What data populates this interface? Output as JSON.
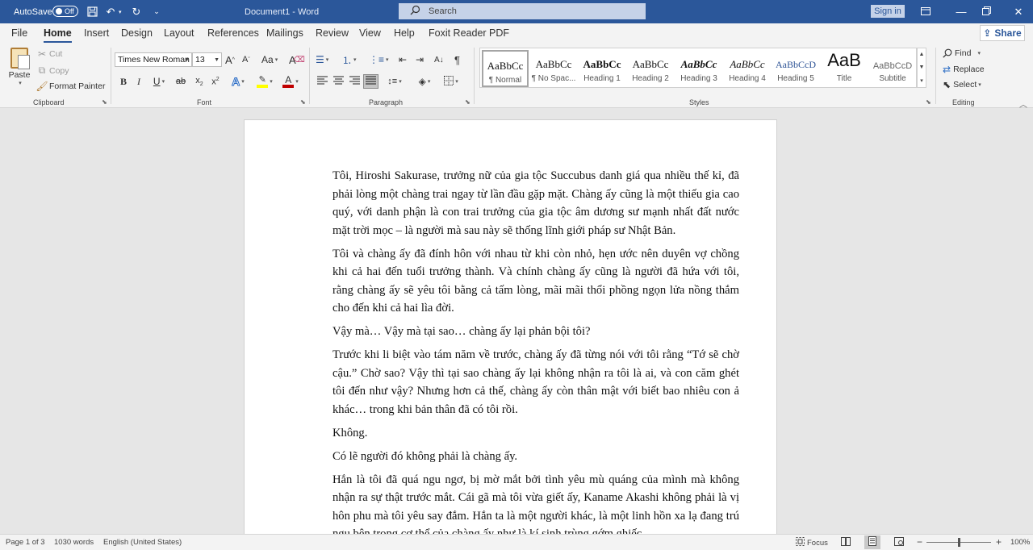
{
  "titlebar": {
    "autosave_label": "AutoSave",
    "autosave_state": "Off",
    "doc_title": "Document1  -  Word",
    "search_placeholder": "Search",
    "signin_label": "Sign in"
  },
  "tabs": [
    "File",
    "Home",
    "Insert",
    "Design",
    "Layout",
    "References",
    "Mailings",
    "Review",
    "View",
    "Help",
    "Foxit Reader PDF"
  ],
  "active_tab": "Home",
  "share_label": "Share",
  "clipboard": {
    "paste_label": "Paste",
    "cut_label": "Cut",
    "copy_label": "Copy",
    "format_painter_label": "Format Painter",
    "group_label": "Clipboard"
  },
  "font": {
    "name": "Times New Roman",
    "size": "13",
    "group_label": "Font"
  },
  "paragraph": {
    "group_label": "Paragraph"
  },
  "styles": {
    "group_label": "Styles",
    "items": [
      {
        "sample": "AaBbCc",
        "name": "¶ Normal"
      },
      {
        "sample": "AaBbCc",
        "name": "¶ No Spac..."
      },
      {
        "sample": "AaBbCc",
        "name": "Heading 1"
      },
      {
        "sample": "AaBbCc",
        "name": "Heading 2"
      },
      {
        "sample": "AaBbCc",
        "name": "Heading 3"
      },
      {
        "sample": "AaBbCc",
        "name": "Heading 4"
      },
      {
        "sample": "AaBbCcD",
        "name": "Heading 5"
      },
      {
        "sample": "AaB",
        "name": "Title"
      },
      {
        "sample": "AaBbCcD",
        "name": "Subtitle"
      }
    ]
  },
  "editing": {
    "find_label": "Find",
    "replace_label": "Replace",
    "select_label": "Select",
    "group_label": "Editing"
  },
  "document": {
    "paragraphs": [
      "Tôi, Hiroshi Sakurase, trưởng nữ của gia tộc Succubus danh giá qua nhiều thế kỉ, đã phải lòng một chàng trai ngay từ lần đầu gặp mặt. Chàng ấy cũng là một thiếu gia cao quý, với danh phận là con trai trưởng của gia tộc âm dương sư mạnh nhất đất nước mặt trời mọc – là người mà sau này sẽ thống lĩnh giới pháp sư Nhật Bản.",
      "Tôi và chàng ấy đã đính hôn với nhau từ khi còn nhỏ, hẹn ước nên duyên vợ chồng khi cả hai đến tuổi trưởng thành. Và chính chàng ấy cũng là người đã hứa với tôi, rằng chàng ấy sẽ yêu tôi bằng cả tấm lòng, mãi mãi thổi phồng ngọn lửa nồng thắm cho đến khi cả hai lìa đời.",
      "Vậy mà… Vậy mà tại sao… chàng ấy lại phản bội tôi?",
      "Trước khi li biệt vào tám năm về trước, chàng ấy đã từng nói với tôi rằng “Tớ sẽ chờ cậu.” Chờ sao? Vậy thì tại sao chàng ấy lại không nhận ra tôi là ai, và con căm ghét tôi đến như vậy? Nhưng hơn cả thế, chàng ấy còn thân mật với biết bao nhiêu con ả khác… trong khi bản thân đã có tôi rồi.",
      "Không.",
      "Có lẽ người đó không phải là chàng ấy.",
      "Hắn là tôi đã quá ngu ngơ, bị mờ mắt bởi tình yêu mù quáng của mình mà không nhận ra sự thật trước mắt. Cái gã mà tôi vừa giết ấy, Kaname Akashi không phải là vị hôn phu mà tôi yêu say đắm. Hắn ta là một người khác, là một linh hồn xa lạ đang trú ngụ bên trong cơ thể của chàng ấy như là kí sinh trùng gớm ghiếc."
    ]
  },
  "statusbar": {
    "page": "Page 1 of 3",
    "words": "1030 words",
    "language": "English (United States)",
    "focus_label": "Focus",
    "zoom": "100%"
  },
  "colors": {
    "titlebar": "#2b579a",
    "highlight": "#ffff00",
    "font_color": "#c00000"
  }
}
